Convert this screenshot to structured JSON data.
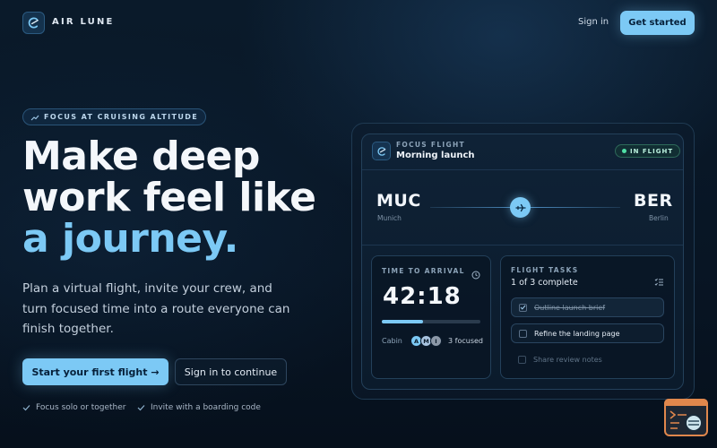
{
  "header": {
    "brand": "AIR LUNE",
    "signin_label": "Sign in",
    "cta_label": "Get started"
  },
  "hero": {
    "eyebrow": "FOCUS AT CRUISING ALTITUDE",
    "headline_lines": [
      "Make deep",
      "work feel like"
    ],
    "headline_accent": "a journey.",
    "subcopy": "Plan a virtual flight, invite your crew, and turn focused time into a route everyone can finish together.",
    "primary_button": "Start your first flight →",
    "secondary_button": "Sign in to continue",
    "checks": [
      "Focus solo or together",
      "Invite with a boarding code"
    ]
  },
  "flight_card": {
    "eyebrow": "FOCUS FLIGHT",
    "title": "Morning launch",
    "status": "IN FLIGHT",
    "origin": {
      "code": "MUC",
      "city": "Munich"
    },
    "destination": {
      "code": "BER",
      "city": "Berlin"
    },
    "flight_progress": 0.47,
    "arrival": {
      "eyebrow": "TIME TO ARRIVAL",
      "timer": "42:18",
      "progress": 0.42,
      "cabin_label": "Cabin",
      "avatars": [
        {
          "initial": "A",
          "color": "#7cc9f5"
        },
        {
          "initial": "M",
          "color": "#a9c4e0"
        },
        {
          "initial": "I",
          "color": "#8d99a8"
        }
      ],
      "focused_label": "3 focused"
    },
    "tasks": {
      "eyebrow": "FLIGHT TASKS",
      "summary": "1 of 3 complete",
      "items": [
        {
          "label": "Outline launch brief",
          "state": "done"
        },
        {
          "label": "Refine the landing page",
          "state": "active"
        },
        {
          "label": "Share review notes",
          "state": "upcoming"
        }
      ]
    }
  },
  "colors": {
    "accent": "#7cc9f5",
    "background": "#0a1a2a",
    "status_green": "#4fe0a6"
  }
}
